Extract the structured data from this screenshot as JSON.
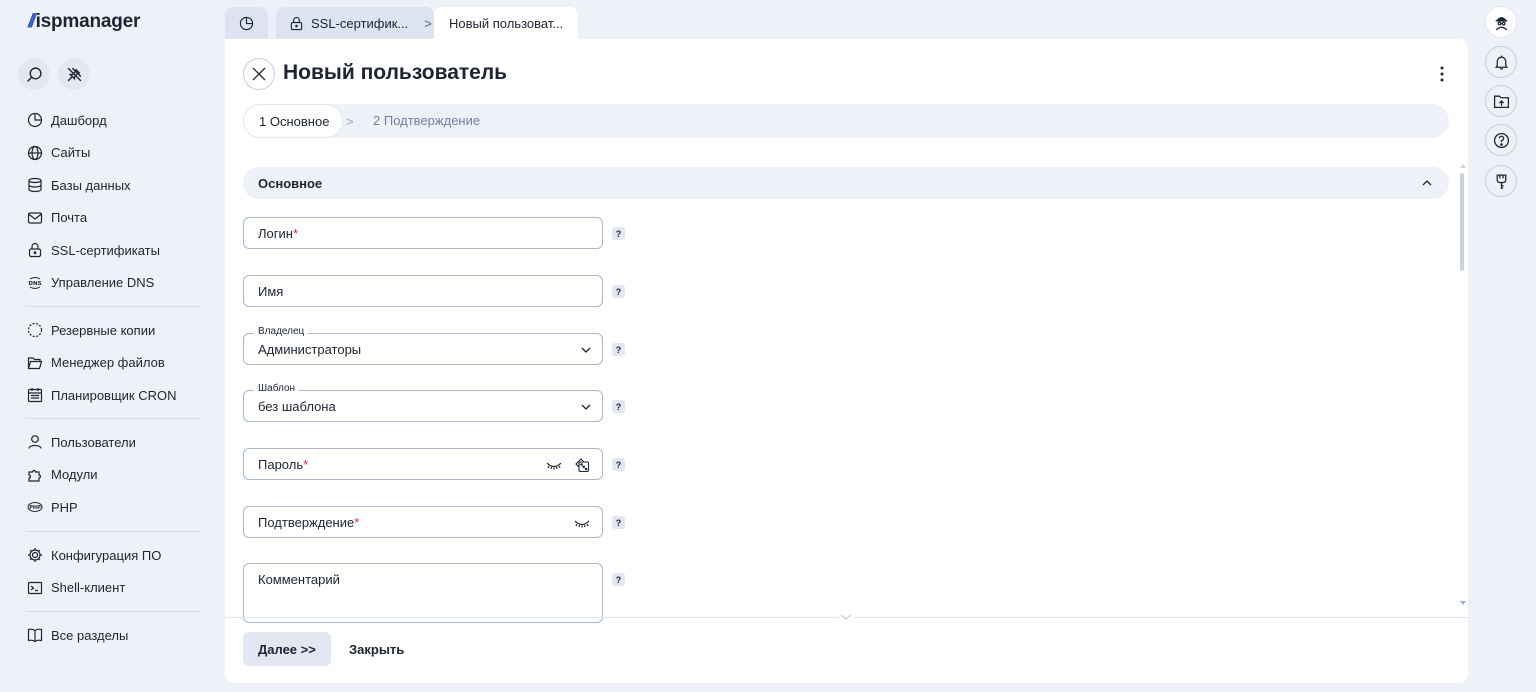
{
  "app": {
    "logo_text": "ispmanager",
    "logo_mark": "//"
  },
  "sidebar": {
    "tools": [
      {
        "icon": "search-icon"
      },
      {
        "icon": "pin-off-icon"
      }
    ],
    "groups": [
      [
        {
          "label": "Дашборд",
          "icon": "dashboard-icon"
        },
        {
          "label": "Сайты",
          "icon": "globe-icon"
        },
        {
          "label": "Базы данных",
          "icon": "database-icon"
        },
        {
          "label": "Почта",
          "icon": "mail-icon"
        },
        {
          "label": "SSL-сертификаты",
          "icon": "lock-icon"
        },
        {
          "label": "Управление DNS",
          "icon": "dns-icon"
        }
      ],
      [
        {
          "label": "Резервные копии",
          "icon": "backup-icon"
        },
        {
          "label": "Менеджер файлов",
          "icon": "folder-icon"
        },
        {
          "label": "Планировщик CRON",
          "icon": "calendar-icon"
        }
      ],
      [
        {
          "label": "Пользователи",
          "icon": "user-icon"
        },
        {
          "label": "Модули",
          "icon": "puzzle-icon"
        },
        {
          "label": "PHP",
          "icon": "php-icon"
        }
      ],
      [
        {
          "label": "Конфигурация ПО",
          "icon": "gear-icon"
        },
        {
          "label": "Shell-клиент",
          "icon": "terminal-icon"
        }
      ],
      [
        {
          "label": "Все разделы",
          "icon": "book-icon"
        }
      ]
    ]
  },
  "tabs": {
    "home_icon": "dashboard-icon",
    "ssl_label": "SSL-сертифик...",
    "separator": ">",
    "active_label": "Новый пользоват..."
  },
  "form": {
    "title": "Новый пользователь",
    "steps": [
      {
        "num": "1",
        "label": "Основное"
      },
      {
        "num": "2",
        "label": "Подтверждение"
      }
    ],
    "section_title": "Основное",
    "fields": {
      "login": {
        "label": "Логин",
        "required": "*"
      },
      "name": {
        "label": "Имя"
      },
      "owner": {
        "label": "Владелец",
        "value": "Администраторы"
      },
      "template": {
        "label": "Шаблон",
        "value": "без шаблона"
      },
      "password": {
        "label": "Пароль",
        "required": "*"
      },
      "confirm": {
        "label": "Подтверждение",
        "required": "*"
      },
      "comment": {
        "label": "Комментарий"
      }
    },
    "help_mark": "?",
    "buttons": {
      "next": "Далее >>",
      "close": "Закрыть"
    }
  },
  "right_rail": [
    {
      "icon": "avatar-icon"
    },
    {
      "icon": "bell-icon"
    },
    {
      "icon": "folder-upload-icon"
    },
    {
      "icon": "help-icon"
    },
    {
      "icon": "key-icon"
    }
  ]
}
